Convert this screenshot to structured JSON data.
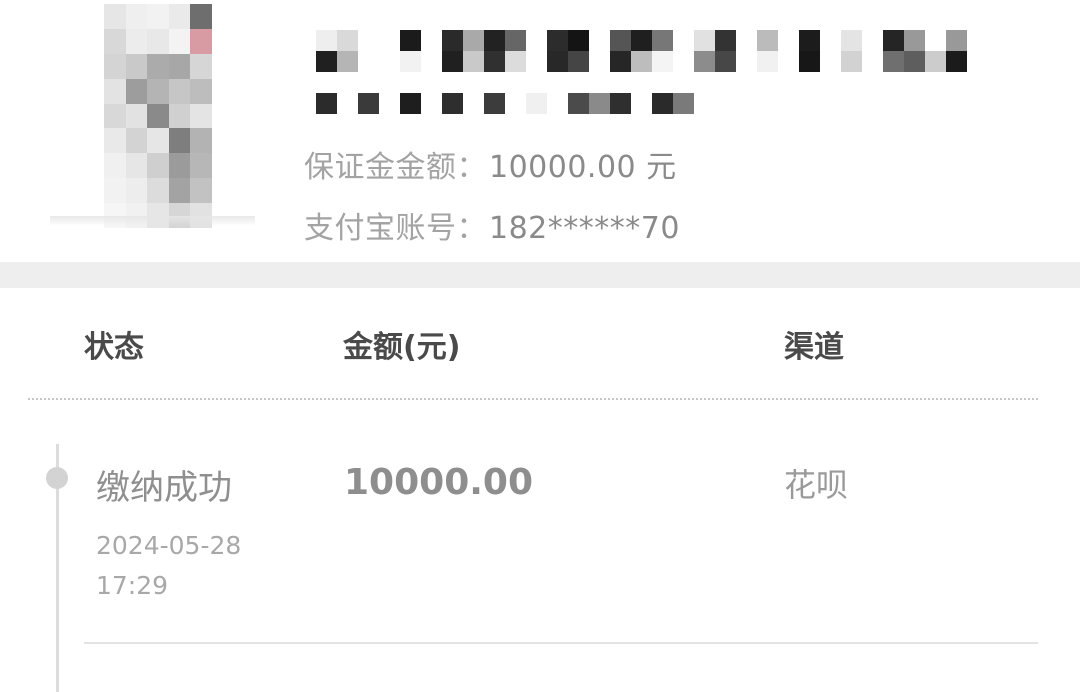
{
  "order": {
    "deposit_label": "保证金金额：",
    "deposit_value": "10000.00 元",
    "alipay_label": "支付宝账号：",
    "alipay_value": "182******70"
  },
  "table": {
    "headers": {
      "status": "状态",
      "amount": "金额(元)",
      "channel": "渠道"
    },
    "rows": [
      {
        "status": "缴纳成功",
        "date": "2024-05-28",
        "time": "17:29",
        "amount": "10000.00",
        "channel": "花呗"
      }
    ]
  },
  "colors": {
    "band": "#eeeeee",
    "divider": "#e3e3e3",
    "timeline": "#dcdcdc"
  }
}
